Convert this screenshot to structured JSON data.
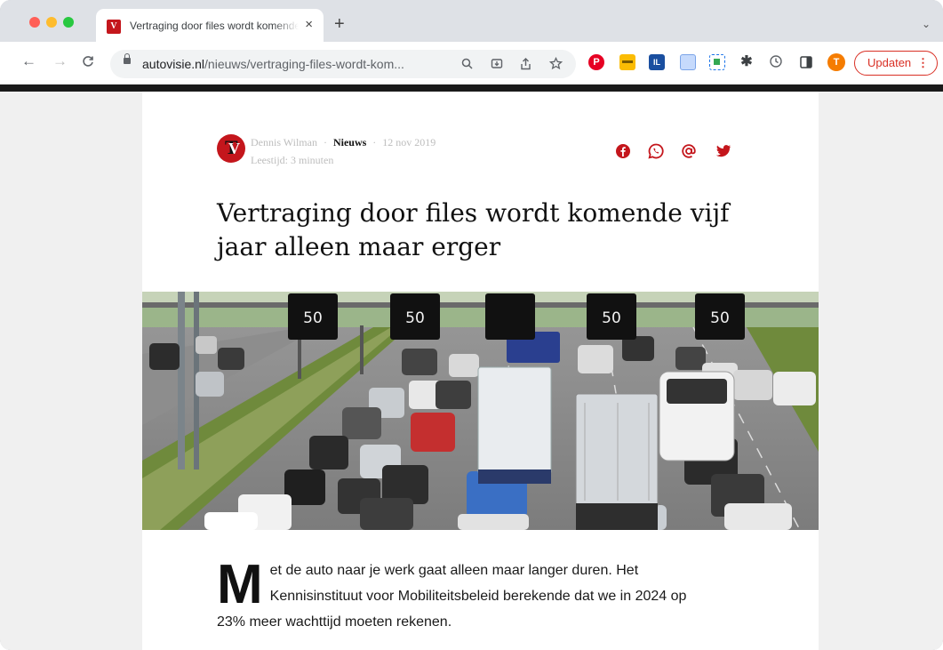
{
  "browser": {
    "tab": {
      "title": "Vertraging door files wordt komende vijf jaar alleen maar erger",
      "favicon": "autovisie-favicon"
    },
    "close_tab": "×",
    "new_tab": "+",
    "tab_menu": "⌄",
    "nav": {
      "back": "←",
      "forward": "→",
      "reload": "C"
    },
    "address": {
      "host": "autovisie.nl",
      "path": "/nieuws/vertraging-files-wordt-kom..."
    },
    "omnibox_icons": [
      "search-icon",
      "install-icon",
      "share-icon",
      "bookmark-star-icon"
    ],
    "extensions": [
      "pinterest-icon",
      "extension-yellow-icon",
      "extension-grid-icon",
      "extension-doc-icon",
      "extension-screenshot-icon",
      "puzzle-icon",
      "history-icon",
      "sidepanel-icon"
    ],
    "profile_initial": "T",
    "update_label": "Updaten",
    "menu_dots": "⋮"
  },
  "article": {
    "author": "Dennis Wilman",
    "separator": "·",
    "category": "Nieuws",
    "date": "12 nov 2019",
    "reading_time": "Leestijd: 3 minuten",
    "share_icons": [
      "facebook-icon",
      "whatsapp-icon",
      "email-icon",
      "twitter-icon"
    ],
    "headline": "Vertraging door files wordt komende vijf jaar alleen maar erger",
    "speed_signs": [
      "50",
      "50",
      "",
      "50",
      "50"
    ],
    "dropcap": "M",
    "intro": "et de auto naar je werk gaat alleen maar langer duren. Het Kennisinstituut voor Mobiliteitsbeleid berekende dat we in 2024 op 23% meer wachttijd moeten rekenen."
  },
  "colors": {
    "brand_red": "#c4161c",
    "update_red": "#d93025"
  }
}
